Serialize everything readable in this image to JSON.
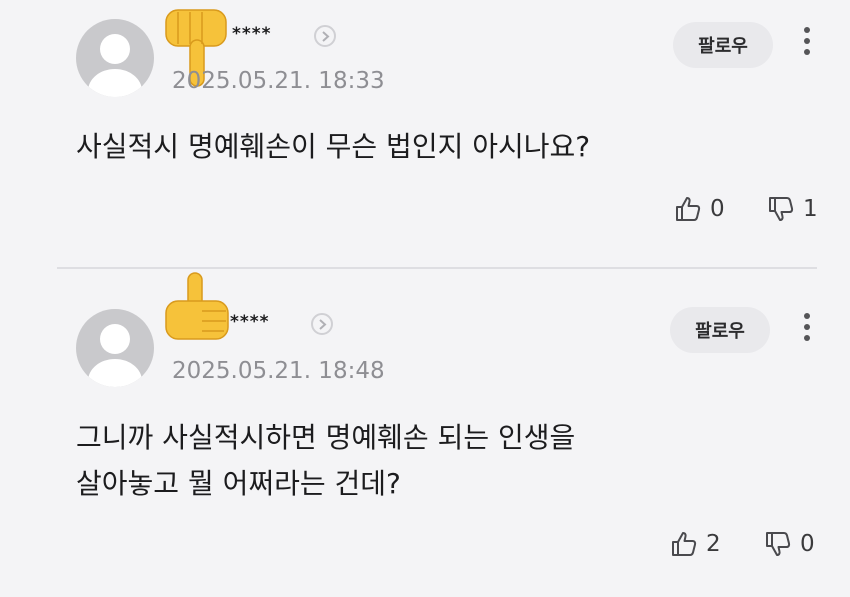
{
  "comments": [
    {
      "masked_name": "****",
      "reaction_emoji": "thumbs-down",
      "timestamp": "2025.05.21. 18:33",
      "follow_label": "팔로우",
      "text": "사실적시 명예훼손이 무슨 법인지 아시나요?",
      "like_count": "0",
      "dislike_count": "1"
    },
    {
      "masked_name": "****",
      "reaction_emoji": "thumbs-up",
      "timestamp": "2025.05.21. 18:48",
      "follow_label": "팔로우",
      "text": "그니까 사실적시하면 명예훼손 되는 인생을\n살아놓고 뭘 어쩌라는 건데?",
      "like_count": "2",
      "dislike_count": "0"
    }
  ],
  "colors": {
    "background": "#f4f4f6",
    "avatar": "#c9c9cc",
    "follow_button": "#e9e9ec",
    "timestamp": "#8e8e93",
    "emoji": "#f6c23a"
  }
}
